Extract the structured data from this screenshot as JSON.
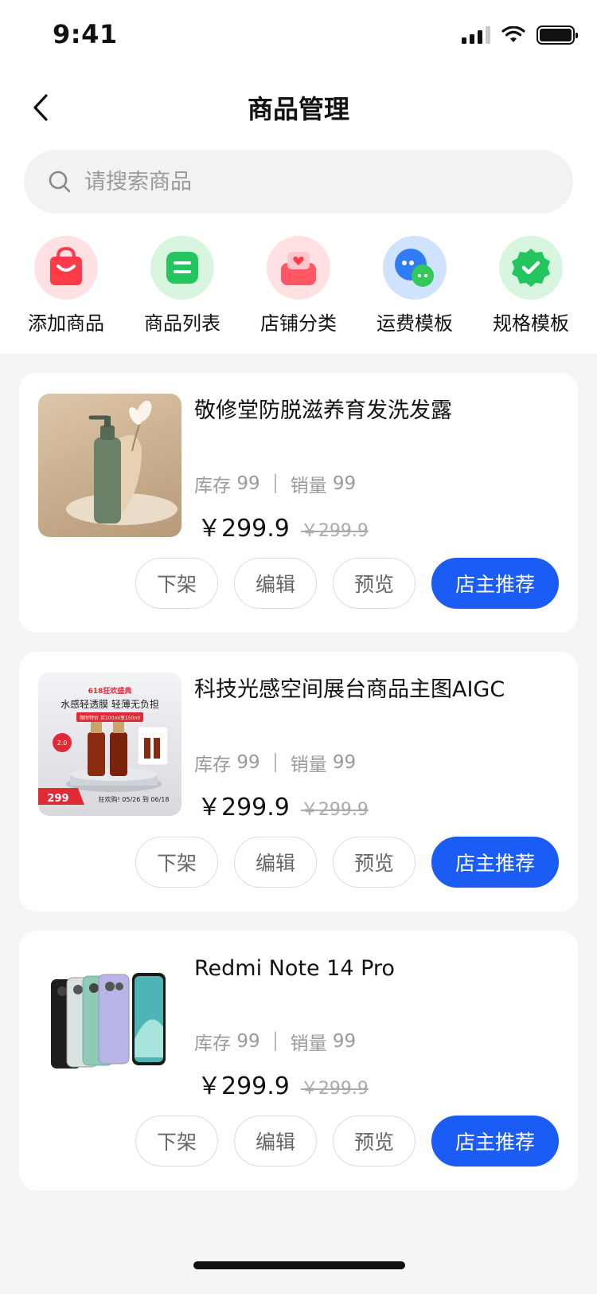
{
  "status_bar": {
    "time": "9:41"
  },
  "header": {
    "title": "商品管理"
  },
  "search": {
    "placeholder": "请搜索商品"
  },
  "categories": [
    {
      "label": "添加商品",
      "icon": "shopping-bag-icon",
      "color": "#ff4d57"
    },
    {
      "label": "商品列表",
      "icon": "list-icon",
      "color": "#22c55e"
    },
    {
      "label": "店铺分类",
      "icon": "store-category-icon",
      "color": "#ff6b78"
    },
    {
      "label": "运费模板",
      "icon": "chat-bubbles-icon",
      "color": "#2f7cf6"
    },
    {
      "label": "规格模板",
      "icon": "verified-badge-icon",
      "color": "#22c55e"
    }
  ],
  "stat_labels": {
    "stock": "库存",
    "sales": "销量"
  },
  "actions": {
    "delist": "下架",
    "edit": "编辑",
    "preview": "预览",
    "recommend": "店主推荐"
  },
  "products": [
    {
      "name": "敬修堂防脱滋养育发洗发露",
      "stock": "99",
      "sales": "99",
      "price": "￥299.9",
      "original_price": "￥299.9"
    },
    {
      "name": "科技光感空间展台商品主图AIGC",
      "stock": "99",
      "sales": "99",
      "price": "￥299.9",
      "original_price": "￥299.9",
      "image_text": {
        "banner": "618狂欢盛典",
        "headline": "水感轻透膜 轻薄无负担",
        "sub": "限时特价 买100ml享150ml",
        "badge": "2.0",
        "price": "299",
        "promo": "狂欢购! 05/26 到 06/18"
      }
    },
    {
      "name": "Redmi Note 14 Pro",
      "stock": "99",
      "sales": "99",
      "price": "￥299.9",
      "original_price": "￥299.9"
    }
  ]
}
